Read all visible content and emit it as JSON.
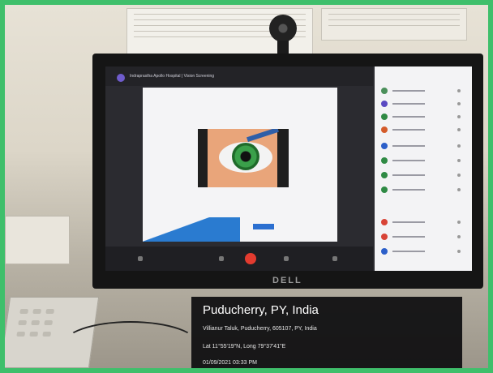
{
  "photo": {
    "monitor_brand": "DELL"
  },
  "screen": {
    "app_title": "Indraprastha Apollo Hospital | Vision Screening"
  },
  "overlay": {
    "location_title": "Puducherry, PY, India",
    "address": "Villianur Taluk, Puducherry, 605107, PY, India",
    "coordinates": "Lat 11°55'19\"N, Long 79°37'41\"E",
    "timestamp": "01/09/2021 03:33 PM"
  },
  "colors": {
    "frame_border": "#3fbf6b",
    "end_call": "#e33b2f",
    "accent_blue": "#2b6fd0"
  }
}
